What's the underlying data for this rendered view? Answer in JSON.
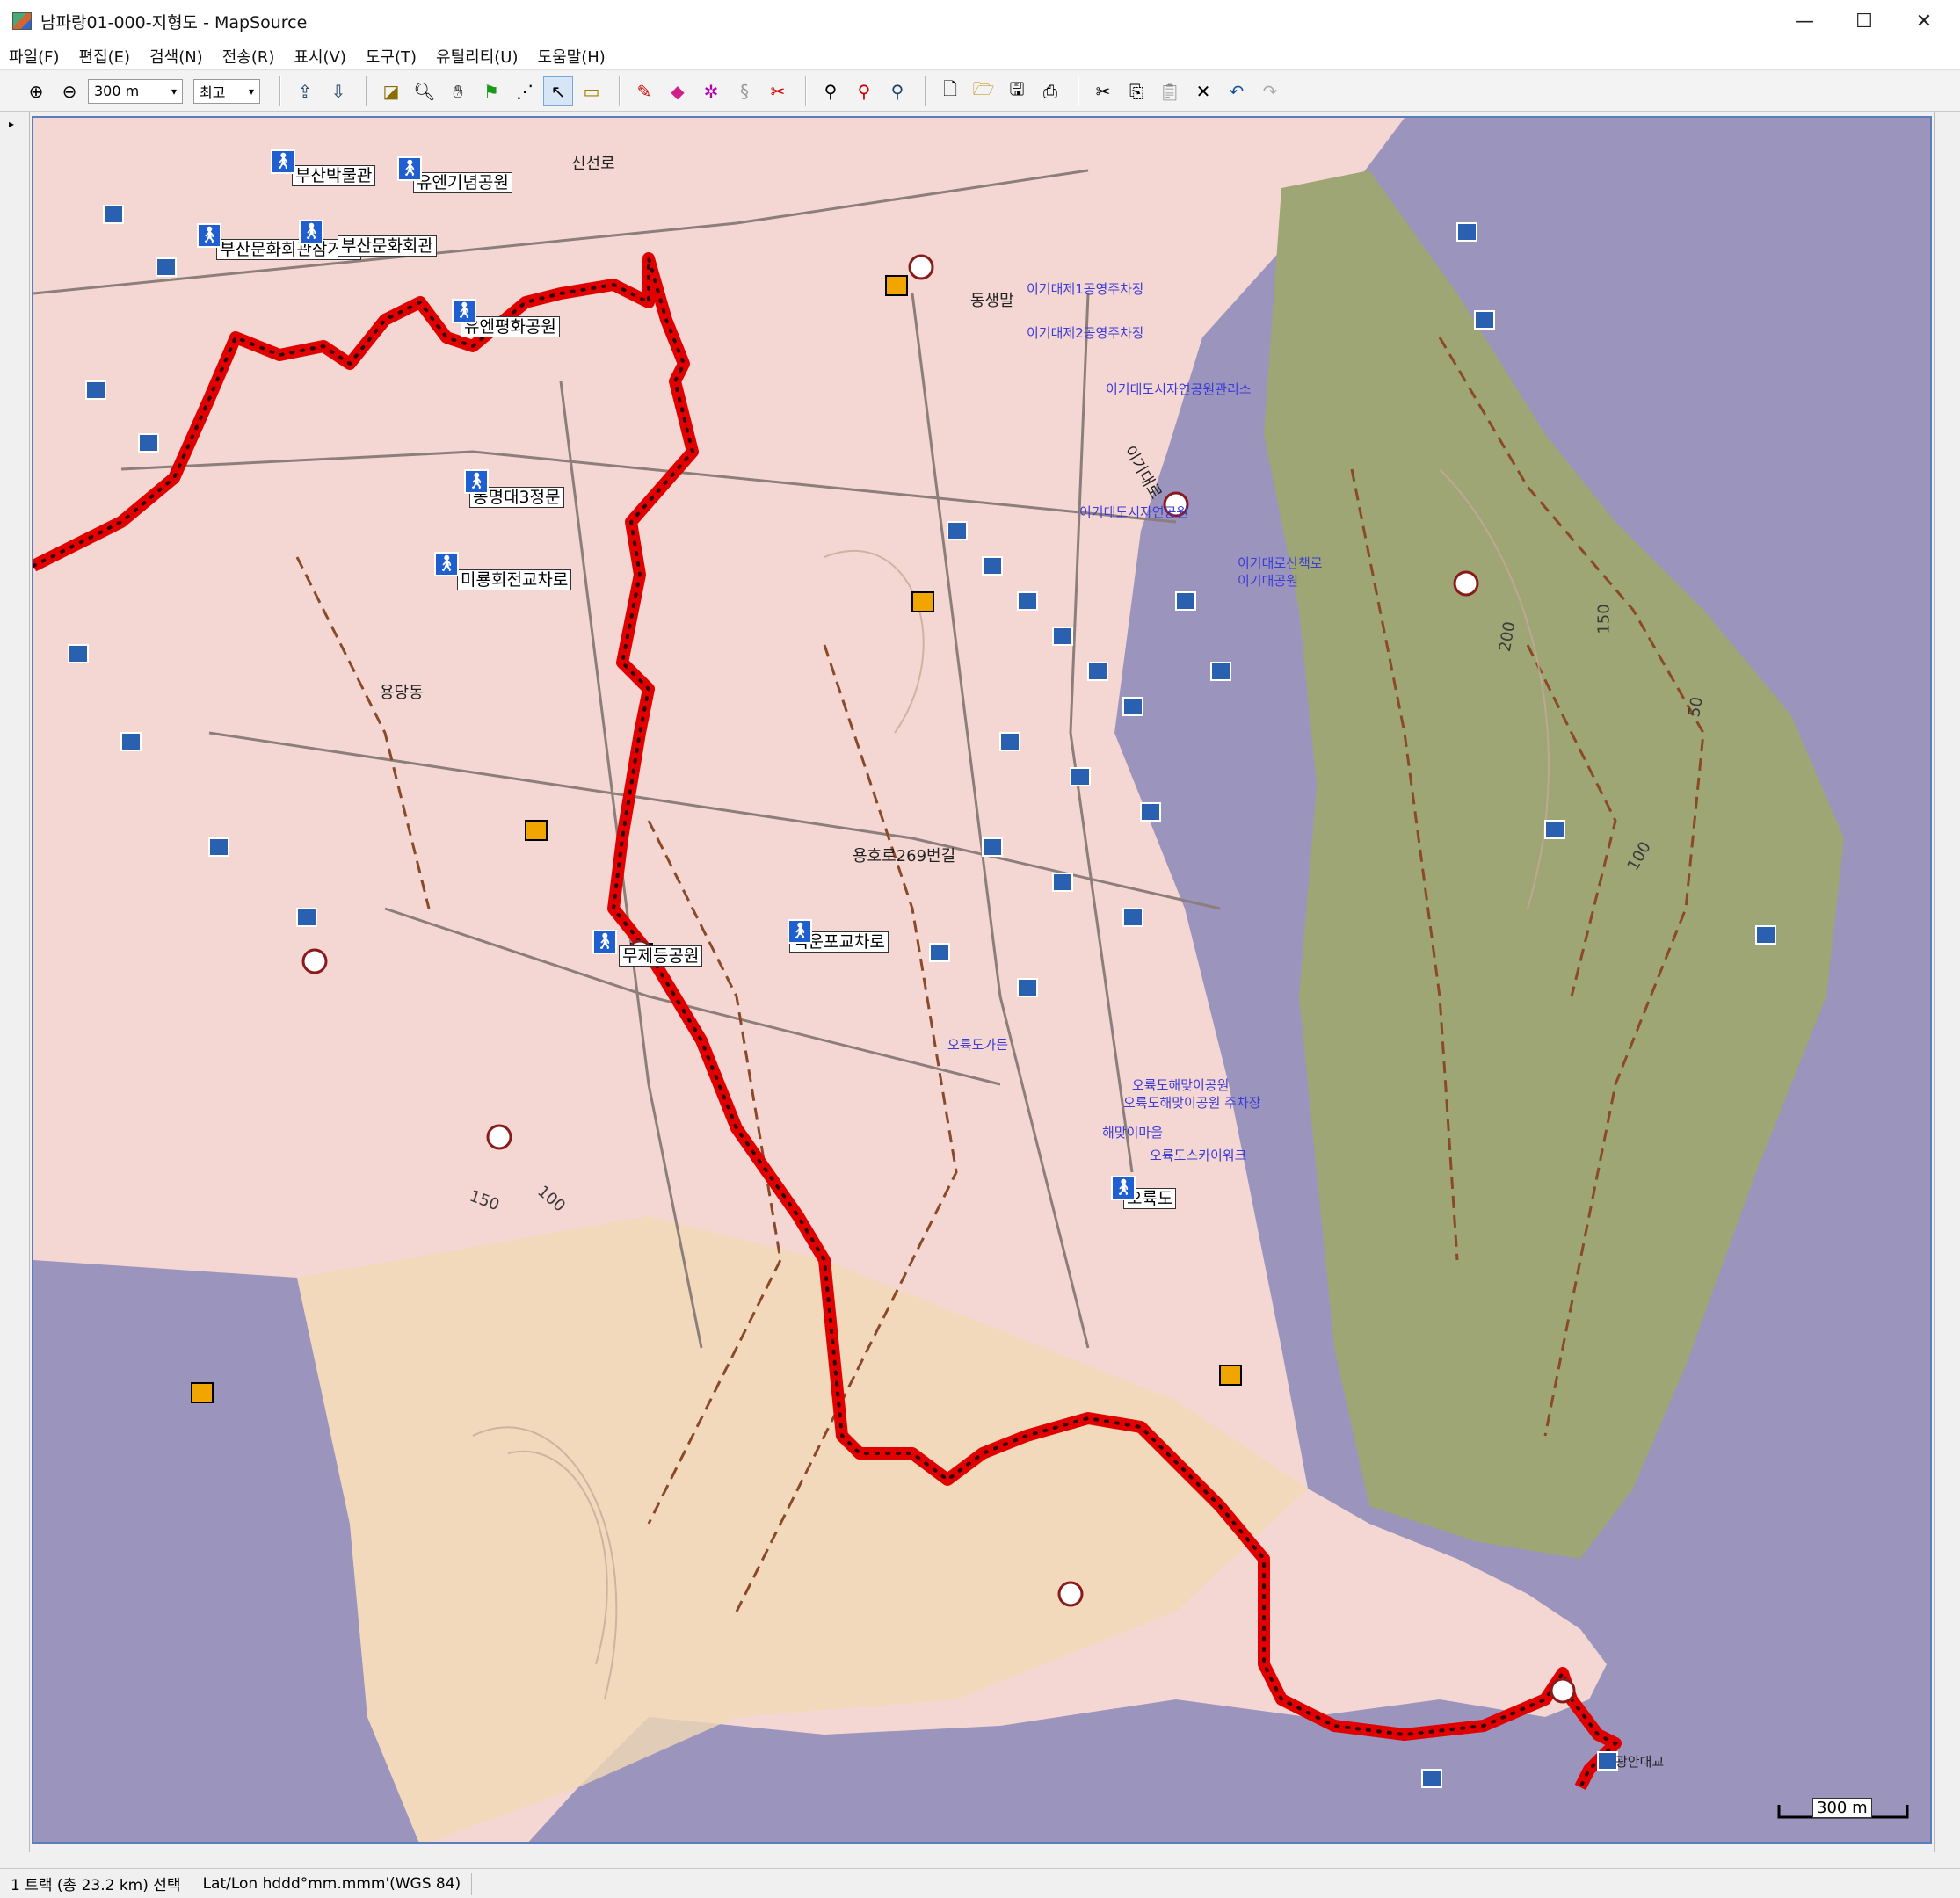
{
  "window": {
    "title": "남파랑01-000-지형도 - MapSource",
    "minimize": "—",
    "maximize": "☐",
    "close": "✕"
  },
  "menu": {
    "items": [
      "파일(F)",
      "편집(E)",
      "검색(N)",
      "전송(R)",
      "표시(V)",
      "도구(T)",
      "유틸리티(U)",
      "도움말(H)"
    ]
  },
  "toolbar": {
    "zoom_scale": "300 m",
    "detail_level": "최고",
    "zoom_in_icon": "zoom-in-icon",
    "zoom_out_icon": "zoom-out-icon"
  },
  "map": {
    "colors": {
      "water": "#9b94bd",
      "land": "#f4d7d2",
      "green": "#9ea676",
      "track": "#e00000"
    },
    "waypoints": [
      {
        "id": "busan-museum",
        "label": "부산박물관"
      },
      {
        "id": "un-memorial",
        "label": "유엔기념공원"
      },
      {
        "id": "culture-center-crossroad",
        "label": "부산문화회관삼거리"
      },
      {
        "id": "culture-center",
        "label": "부산문화회관"
      },
      {
        "id": "un-peace-park",
        "label": "유엔평화공원"
      },
      {
        "id": "tongmyeong-gate",
        "label": "동명대3정문"
      },
      {
        "id": "mirong-rotary",
        "label": "미룡회전교차로"
      },
      {
        "id": "mujedeung-park",
        "label": "무제등공원"
      },
      {
        "id": "baekunpo-crossroad",
        "label": "백운포교차로"
      },
      {
        "id": "oryukdo",
        "label": "오륙도"
      }
    ],
    "place_labels": [
      "신선로",
      "용당동",
      "용호로269번길",
      "동생말",
      "이기대로",
      "광안대교"
    ],
    "poi_labels": [
      "이기대제1공영주차장",
      "이기대제2공영주차장",
      "이기대도시자연공원관리소",
      "오륙도스카이워크",
      "오륙도해맞이공원",
      "이기대도시자연공원",
      "이기대공원",
      "오륙도해맞이공원 주차장",
      "이기대로산책로",
      "오륙도가든",
      "해맞이마을"
    ],
    "contours": [
      "150",
      "200",
      "100",
      "50",
      "150",
      "100"
    ]
  },
  "scale_bar": {
    "label": "300 m"
  },
  "status": {
    "selection": "1 트랙 (총 23.2 km) 선택",
    "coord_format": "Lat/Lon hddd°mm.mmm'(WGS 84)"
  }
}
